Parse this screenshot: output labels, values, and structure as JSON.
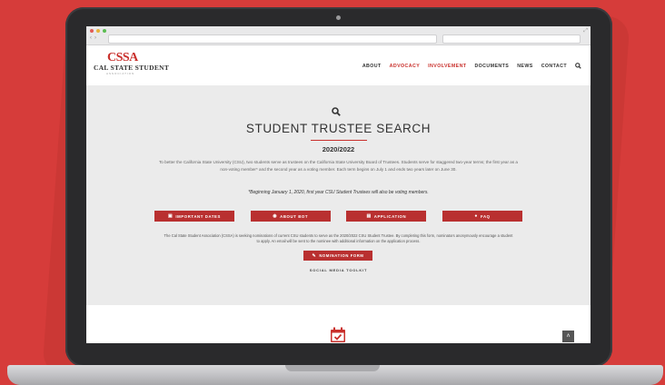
{
  "site": {
    "logo_top": "CSSA",
    "logo_mid": "CAL STATE STUDENT",
    "logo_bottom": "ASSOCIATION"
  },
  "nav": {
    "items": [
      "ABOUT",
      "ADVOCACY",
      "INVOLVEMENT",
      "DOCUMENTS",
      "NEWS",
      "CONTACT"
    ],
    "active": [
      "ADVOCACY",
      "INVOLVEMENT"
    ]
  },
  "hero": {
    "title": "STUDENT TRUSTEE SEARCH",
    "year": "2020/2022",
    "description": "To better the California State University (CSU), two students serve as trustees on the California State University Board of Trustees. Students serve for staggered two-year terms; the first year as a non-voting member* and the second year as a voting member. Each term begins on July 1 and ends two years later on June 30.",
    "note": "*Beginning January 1, 2020, first year CSU Student Trustees will also be voting members.",
    "buttons": [
      {
        "label": "IMPORTANT DATES",
        "icon": "calendar-icon"
      },
      {
        "label": "ABOUT BOT",
        "icon": "eye-icon"
      },
      {
        "label": "APPLICATION",
        "icon": "document-icon"
      },
      {
        "label": "FAQ",
        "icon": "question-icon"
      }
    ],
    "description2": "The Cal State Student Association (CSSA) is seeking nominations of current CSU students to serve as the 2020/2022 CSU Student Trustee. By completing this form, nominators anonymously encourage a student to apply. An email will be sent to the nominee with additional information on the application process.",
    "nomination_label": "NOMINATION FORM",
    "toolkit_label": "SOCIAL MEDIA TOOLKIT"
  },
  "colors": {
    "background": "#d63c3a",
    "accent": "#b93030",
    "hero_bg": "#ebebeb"
  }
}
